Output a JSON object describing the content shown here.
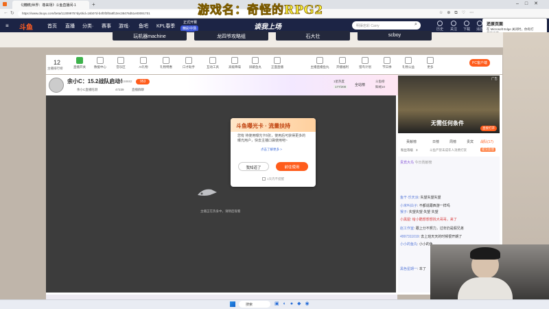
{
  "overlay": {
    "game_title": "游戏名：奇怪的RPG2"
  },
  "browser": {
    "tab_title": "《(糟糕)世界：尊来场》斗鱼直播间-1",
    "url": "https://www.douyu.com/beta/11309975?dyshid=16b07d-b4f0f3f0a8f10ec38476d51e00091701"
  },
  "site_nav": {
    "logo": "斗鱼",
    "items": [
      "首页",
      "直播",
      "分类·",
      "赛事",
      "游戏·",
      "鱼吧",
      "KPL春季"
    ],
    "promo_top": "正式开赛",
    "promo_bottom": "精彩中场",
    "banner": "谈我上场",
    "search_placeholder": "明渠岩彩 Carry",
    "icons": [
      "历史",
      "关注",
      "下载",
      "消息",
      "创作中心"
    ]
  },
  "toast": {
    "title": "还原页面",
    "body": "在 Microsoft Edge 关闭时，你有打开的页面。",
    "button": "还原"
  },
  "rec_chips": [
    "玩机器machine",
    "龙四爷攻略组",
    "石大壮",
    "scboy"
  ],
  "category_bar": {
    "count": "12",
    "count_label": "主播排行榜",
    "items": [
      "直播开关",
      "数据中心",
      "音乐区",
      "AI礼物",
      "礼物特惠",
      "口才助手",
      "互动工具",
      "高级降噪",
      "屏蔽鱼丸",
      "正面直播",
      "更多"
    ],
    "right_items": [
      "主播直播鱼丸",
      "开播福利",
      "猎鸟计划",
      "节日季",
      "礼物公益",
      "更多"
    ],
    "pc_client": "PC客户端"
  },
  "room": {
    "title": "余小C：15.2战队启动！",
    "room_number": "5158682",
    "fans": "953",
    "followers": "47239",
    "tags": [
      "余小C直播陪测",
      "直播群聊"
    ],
    "rank_label": "1星热度",
    "rank_value": "177/200",
    "fans_club": "全站榜",
    "hot_label": "斗鱼榜",
    "hot_value": "鲜绒10"
  },
  "video": {
    "buffering_text": "主播正在热身中，请稍后观看"
  },
  "modal": {
    "title": "斗鱼曝光卡 · 流量扶持",
    "body": "您有 待使用曝光卡6张，使用后可获得更多的曝光用户，快去主播口袋使用吧~",
    "link": "点击了解更多 >",
    "cancel": "我知道了",
    "confirm": "前往使用",
    "checkbox": "1天内不提醒"
  },
  "ad": {
    "label": "广告",
    "caption": "无需任何条件",
    "button": "直接打开"
  },
  "side_tabs": [
    "贡献榜",
    "日榜",
    "周榜",
    "贵宾",
    "战队(17)"
  ],
  "side_sub": [
    "粉丝等级",
    "3",
    "斗鱼严禁未成年人消费打赏",
    "提交反馈"
  ],
  "chat": [
    {
      "name": "贵宾大鸟",
      "text": "今日贡献榜"
    },
    {
      "name": "鱼干·乐天派",
      "text": "失望失望失望"
    },
    {
      "name": "小米叫白子",
      "text": "不都说跟西游一样吗"
    },
    {
      "name": "猴子",
      "text": "失望失望 失望 失望"
    },
    {
      "name": "小黑屋",
      "text": "给小酷想想想找大哥哥，来了"
    },
    {
      "name": "赵工作室",
      "text": "跟上分不努力，过年仍是假兄弟"
    },
    {
      "name": "4997311019",
      "text": "去上班天天的时候很开朗了"
    },
    {
      "name": "小小的鱼丸",
      "text": "小小的鱼"
    },
    {
      "name": "黑色星期一",
      "text": "本了"
    }
  ],
  "taskbar": {
    "search": "搜索"
  }
}
